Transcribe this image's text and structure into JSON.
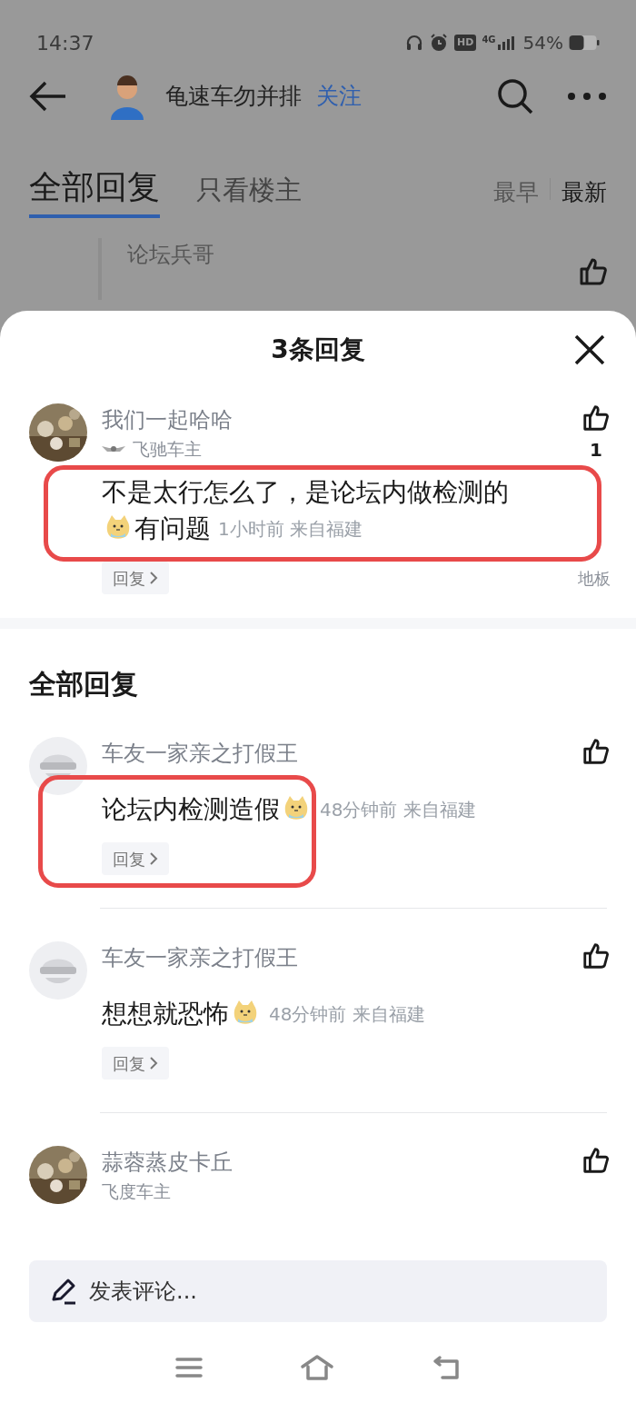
{
  "status_bar": {
    "time": "14:37",
    "hd": "HD",
    "network": "4G",
    "battery": "54%"
  },
  "header": {
    "username": "龟速车勿并排",
    "follow": "关注"
  },
  "tabs": [
    {
      "label": "全部回复",
      "selected": true
    },
    {
      "label": "只看楼主",
      "selected": false
    }
  ],
  "sort": [
    {
      "label": "最早",
      "selected": false
    },
    {
      "label": "最新",
      "selected": true
    }
  ],
  "background_reply": {
    "author": "论坛兵哥"
  },
  "sheet": {
    "title": "3条回复",
    "main_comment": {
      "author": "我们一起哈哈",
      "badge": "飞驰车主",
      "body": [
        {
          "kind": "text",
          "text": "不是太行怎么了，是论坛内做检测的"
        },
        {
          "kind": "sticker"
        },
        {
          "kind": "text",
          "text": "有问题"
        }
      ],
      "meta": "1小时前 来自福建",
      "likes": "1",
      "reply": "回复",
      "floor": "地板",
      "highlighted": true
    },
    "section_title": "全部回复",
    "replies": [
      {
        "avatar": {
          "kind": "mascot"
        },
        "author": "车友一家亲之打假王",
        "body": [
          {
            "kind": "text",
            "text": "论坛内检测造假"
          },
          {
            "kind": "sticker"
          }
        ],
        "meta": "48分钟前 来自福建",
        "reply": "回复",
        "highlighted": true
      },
      {
        "avatar": {
          "kind": "mascot"
        },
        "author": "车友一家亲之打假王",
        "body": [
          {
            "kind": "text",
            "text": "想想就恐怖"
          },
          {
            "kind": "sticker"
          }
        ],
        "meta": "48分钟前 来自福建",
        "reply": "回复",
        "highlighted": false
      },
      {
        "author": "蒜蓉蒸皮卡丘",
        "badge": "飞度车主",
        "highlighted": false
      }
    ]
  },
  "comment_box": {
    "placeholder": "发表评论..."
  }
}
